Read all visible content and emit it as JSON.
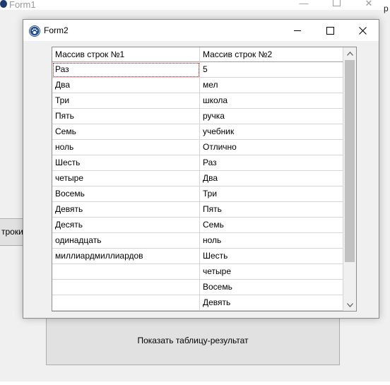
{
  "form1": {
    "title": "Form1",
    "left_button_label": "троки",
    "right_partial_label": "р",
    "show_button_label": "Показать таблицу-результат"
  },
  "form2": {
    "title": "Form2",
    "grid": {
      "columns": [
        "Массив строк  №1",
        "Массив строк  №2"
      ],
      "rows": [
        [
          "Раз",
          "5"
        ],
        [
          "Два",
          "мел"
        ],
        [
          "Три",
          "школа"
        ],
        [
          "Пять",
          "ручка"
        ],
        [
          "Семь",
          "учебник"
        ],
        [
          "ноль",
          "Отлично"
        ],
        [
          "Шесть",
          "Раз"
        ],
        [
          "четыре",
          "Два"
        ],
        [
          "Восемь",
          "Три"
        ],
        [
          "Девять",
          "Пять"
        ],
        [
          "Десять",
          "Семь"
        ],
        [
          "одинадцать",
          "ноль"
        ],
        [
          "миллиардмиллиардов",
          "Шесть"
        ],
        [
          "",
          "четыре"
        ],
        [
          "",
          "Восемь"
        ],
        [
          "",
          "Девять"
        ]
      ]
    }
  },
  "icons": {
    "form1_app": "delphi-app-icon",
    "form2_app": "paw-icon",
    "minimize": "minimize-icon",
    "maximize": "maximize-icon",
    "close": "close-icon",
    "scroll_up": "chevron-up-icon",
    "scroll_down": "chevron-down-icon"
  }
}
